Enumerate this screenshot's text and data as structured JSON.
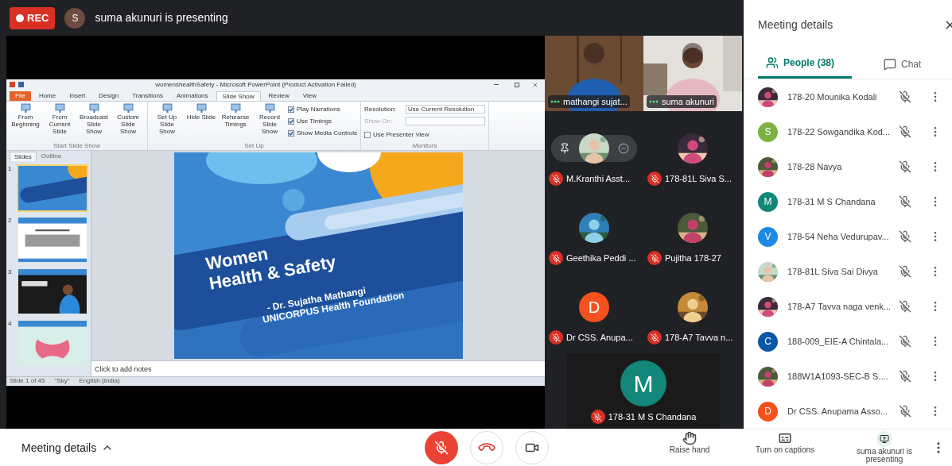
{
  "top_bar": {
    "rec": {
      "label": "REC",
      "on": true
    },
    "presenter_avatar": {
      "initial": "S",
      "color": "#6d4c41"
    },
    "presenting_text": "suma akunuri is presenting"
  },
  "shared_screen": {
    "title": "womenshealthSafety - Microsoft PowerPoint (Product Activation Failed)",
    "ribbon_tabs": [
      {
        "label": "File",
        "kind": "file",
        "selected": false
      },
      {
        "label": "Home",
        "kind": "tab",
        "selected": false
      },
      {
        "label": "Insert",
        "kind": "tab",
        "selected": false
      },
      {
        "label": "Design",
        "kind": "tab",
        "selected": false
      },
      {
        "label": "Transitions",
        "kind": "tab",
        "selected": false
      },
      {
        "label": "Animations",
        "kind": "tab",
        "selected": false
      },
      {
        "label": "Slide Show",
        "kind": "tab",
        "selected": true
      },
      {
        "label": "Review",
        "kind": "tab",
        "selected": false
      },
      {
        "label": "View",
        "kind": "tab",
        "selected": false
      }
    ],
    "ribbon_groups": [
      {
        "title": "Start Slide Show",
        "buttons": [
          "From Beginning",
          "From Current Slide",
          "Broadcast Slide Show",
          "Custom Slide Show"
        ]
      },
      {
        "title": "Set Up",
        "buttons": [
          "Set Up Slide Show",
          "Hide Slide",
          "Rehearse Timings",
          "Record Slide Show"
        ],
        "checks": [
          {
            "label": "Play Narrations",
            "checked": true
          },
          {
            "label": "Use Timings",
            "checked": true
          },
          {
            "label": "Show Media Controls",
            "checked": true
          }
        ]
      },
      {
        "title": "Monitors",
        "fields": [
          {
            "label": "Resolution:",
            "value": "Use Current Resolution",
            "disabled": false
          },
          {
            "label": "Show On:",
            "disabled": true
          }
        ],
        "checks": [
          {
            "label": "Use Presenter View",
            "checked": false
          }
        ]
      }
    ],
    "pane_tabs": [
      {
        "label": "Slides",
        "selected": true
      },
      {
        "label": "Outline",
        "selected": false
      }
    ],
    "thumbnails": [
      {
        "number": "1",
        "kind": "title",
        "selected": true
      },
      {
        "number": "2",
        "kind": "text",
        "selected": false
      },
      {
        "number": "3",
        "selected": false
      },
      {
        "number": "4",
        "kind": "diagram",
        "selected": false
      }
    ],
    "slide": {
      "title_lines": [
        "Women",
        "Health & Safety"
      ],
      "subtitle_lines": [
        "-  Dr. Sujatha Mathangi",
        "UNICORPUS Health Foundation"
      ]
    },
    "notes_placeholder": "Click to add notes",
    "status_items": [
      "Slide 1 of 45",
      "\"Sky\"",
      "English (India)"
    ]
  },
  "video_tiles": [
    {
      "name": "mathangi sujat..."
    },
    {
      "name": "suma akunuri"
    }
  ],
  "participant_tiles": [
    {
      "name": "M.Kranthi Asst...",
      "muted": true,
      "hover_controls": true
    },
    {
      "name": "178-81L Siva S...",
      "muted": true,
      "hover_controls": false
    },
    {
      "name": "Geethika Peddi ...",
      "muted": true,
      "hover_controls": false
    },
    {
      "name": "Pujitha 178-27",
      "muted": true,
      "hover_controls": false
    },
    {
      "name": "Dr CSS. Anupa...",
      "muted": true,
      "hover_controls": false,
      "avatar": {
        "kind": "letter",
        "initial": "D",
        "color": "#f4511e"
      }
    },
    {
      "name": "178-A7 Tavva n...",
      "muted": true,
      "hover_controls": false
    }
  ],
  "featured_tile": {
    "name": "178-31 M S Chandana",
    "muted": true,
    "avatar": {
      "kind": "letter",
      "initial": "M",
      "color": "#12877a"
    }
  },
  "side_panel": {
    "title": "Meeting details",
    "tabs": [
      {
        "label": "People (38)",
        "kind": "people",
        "selected": true
      },
      {
        "label": "Chat",
        "kind": "chat",
        "selected": false
      }
    ],
    "participants": [
      {
        "name": "178-20 Mounika Kodali",
        "muted": true
      },
      {
        "name": "178-22 Sowgandika Kod...",
        "muted": true,
        "avatar": {
          "kind": "letter",
          "initial": "S",
          "color": "#7cb342"
        }
      },
      {
        "name": "178-28 Navya",
        "muted": true
      },
      {
        "name": "178-31 M S Chandana",
        "muted": true,
        "avatar": {
          "kind": "letter",
          "initial": "M",
          "color": "#12877a"
        }
      },
      {
        "name": "178-54 Neha Vedurupav...",
        "muted": true,
        "avatar": {
          "kind": "letter",
          "initial": "V",
          "color": "#1e88e5"
        }
      },
      {
        "name": "178-81L Siva Sai Divya",
        "muted": true
      },
      {
        "name": "178-A7 Tavva naga venk...",
        "muted": true
      },
      {
        "name": "188-009_EIE-A Chintala...",
        "muted": true,
        "avatar": {
          "kind": "letter",
          "initial": "C",
          "color": "#0b57a8"
        }
      },
      {
        "name": "188W1A1093-SEC-B S....",
        "muted": true
      },
      {
        "name": "Dr CSS. Anupama Asso...",
        "muted": true,
        "avatar": {
          "kind": "letter",
          "initial": "D",
          "color": "#f4511e"
        }
      }
    ]
  },
  "bottom_bar": {
    "details_label": "Meeting details",
    "controls": [
      {
        "kind": "mic",
        "on": false
      },
      {
        "kind": "hangup"
      },
      {
        "kind": "camera",
        "on": true
      }
    ],
    "actions": [
      {
        "kind": "raise_hand",
        "label": "Raise hand"
      },
      {
        "kind": "captions",
        "label": "Turn on captions"
      },
      {
        "kind": "present",
        "label": "suma akunuri is presenting"
      }
    ]
  }
}
